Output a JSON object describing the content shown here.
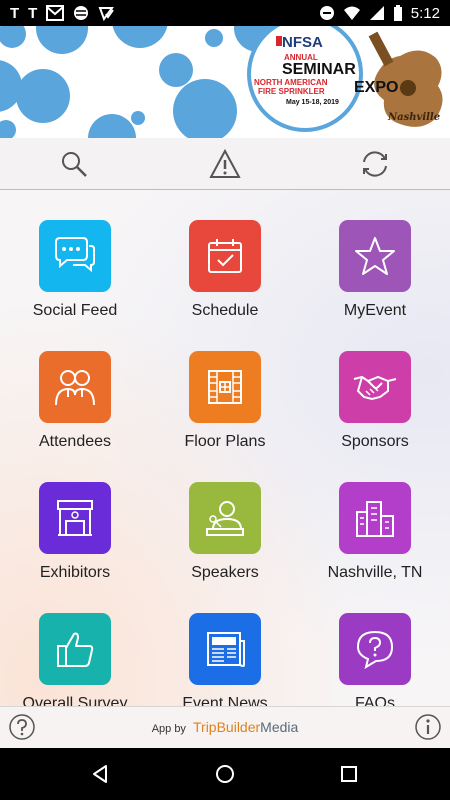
{
  "status_bar": {
    "left_icons": [
      "T",
      "T"
    ],
    "time": "5:12",
    "icons": [
      "gmail-icon",
      "circle-icon",
      "check-icon",
      "dnd-icon",
      "wifi-icon",
      "battery-icon"
    ]
  },
  "banner": {
    "org": "NFSA",
    "annual": "ANNUAL",
    "seminar": "SEMINAR",
    "north": "NORTH AMERICAN",
    "fire": "FIRE SPRINKLER",
    "expo": "EXPO",
    "dates": "May 15-18, 2019",
    "city": "Nashville",
    "colors": {
      "bubble": "#5aa6dc",
      "red": "#d9262c",
      "guitar": "#a9743d"
    }
  },
  "toolbar": {
    "icons": [
      "search-icon",
      "warning-icon",
      "sync-icon"
    ]
  },
  "tiles": [
    {
      "label": "Social Feed",
      "color": "#14b6ef",
      "icon": "chat-icon"
    },
    {
      "label": "Schedule",
      "color": "#e8483c",
      "icon": "calendar-icon"
    },
    {
      "label": "MyEvent",
      "color": "#9d55b8",
      "icon": "star-icon"
    },
    {
      "label": "Attendees",
      "color": "#ea6d2b",
      "icon": "people-icon"
    },
    {
      "label": "Floor Plans",
      "color": "#ee7d22",
      "icon": "floorplan-icon"
    },
    {
      "label": "Sponsors",
      "color": "#cd3ea9",
      "icon": "handshake-icon"
    },
    {
      "label": "Exhibitors",
      "color": "#6a2bd9",
      "icon": "booth-icon"
    },
    {
      "label": "Speakers",
      "color": "#99b93e",
      "icon": "speaker-icon"
    },
    {
      "label": "Nashville, TN",
      "color": "#b23ec9",
      "icon": "city-icon"
    },
    {
      "label": "Overall Survey",
      "color": "#18b2ac",
      "icon": "thumbs-up-icon"
    },
    {
      "label": "Event News",
      "color": "#1c6ee6",
      "icon": "news-icon"
    },
    {
      "label": "FAQs",
      "color": "#9b3bc3",
      "icon": "question-icon"
    }
  ],
  "footer": {
    "app_by": "App by",
    "brand_a": "TripBuilder",
    "brand_b": "Media"
  },
  "nav": {
    "buttons": [
      "back-icon",
      "home-icon",
      "recents-icon"
    ]
  }
}
